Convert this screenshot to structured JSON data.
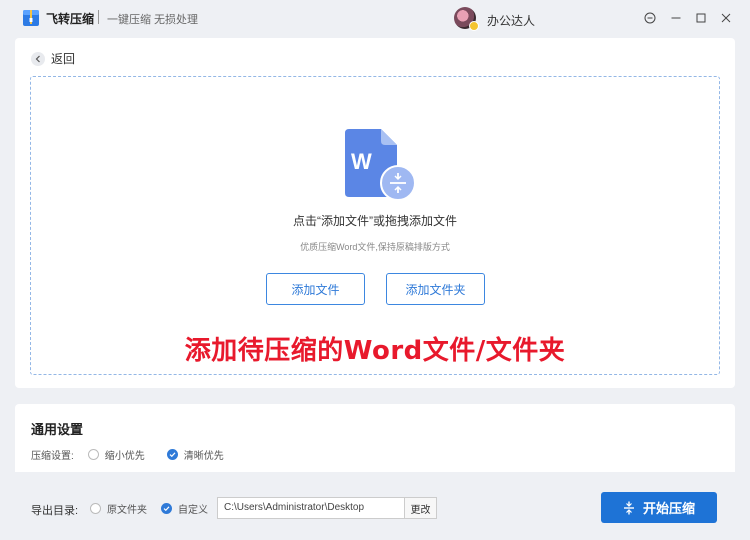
{
  "window": {
    "app_name": "飞转压缩",
    "slogan": "一键压缩 无损处理",
    "username": "办公达人",
    "icons": [
      "app-logo-icon",
      "settings-icon",
      "minimize-icon",
      "maximize-icon",
      "close-icon"
    ]
  },
  "nav": {
    "back_label": "返回"
  },
  "dropzone": {
    "main_text": "点击“添加文件”或拖拽添加文件",
    "sub_text": "优质压缩Word文件,保持原稿排版方式",
    "add_file_label": "添加文件",
    "add_folder_label": "添加文件夹",
    "overlay_caption": "添加待压缩的Word文件/文件夹",
    "icon": "word-document-icon"
  },
  "settings": {
    "title": "通用设置",
    "compress_label": "压缩设置:",
    "options": [
      {
        "label": "缩小优先",
        "checked": false
      },
      {
        "label": "清晰优先",
        "checked": true
      }
    ]
  },
  "export": {
    "label": "导出目录:",
    "options": [
      {
        "label": "原文件夹",
        "checked": false
      },
      {
        "label": "自定义",
        "checked": true
      }
    ],
    "path": "C:\\Users\\Administrator\\Desktop",
    "change_label": "更改"
  },
  "start_label": "开始压缩",
  "colors": {
    "accent": "#1e73d6",
    "caption_red": "#e8192c",
    "dash_border": "#93b7e6"
  }
}
